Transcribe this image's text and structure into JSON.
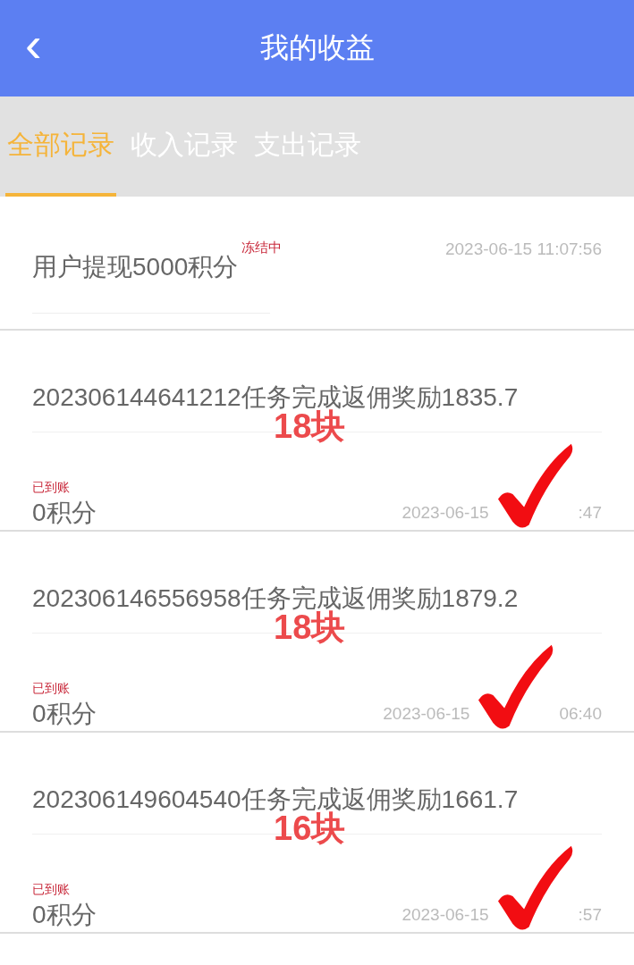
{
  "header": {
    "back": "‹",
    "title": "我的收益"
  },
  "tabs": [
    {
      "label": "全部记录",
      "selected": true
    },
    {
      "label": "收入记录",
      "selected": false
    },
    {
      "label": "支出记录",
      "selected": false
    }
  ],
  "records": [
    {
      "kind": "withdrawal",
      "title": "用户提现5000积分",
      "status": "冻结中",
      "date": "2023-06-15 11:07:56"
    },
    {
      "kind": "reward",
      "title": "202306144641212任务完成返佣奖励1835.7",
      "title_continued": "0积分",
      "status": "已到账",
      "date": "2023-06-15",
      "time_visible": ":47",
      "annotation": "18块"
    },
    {
      "kind": "reward",
      "title": "202306146556958任务完成返佣奖励1879.2",
      "title_continued": "0积分",
      "status": "已到账",
      "date": "2023-06-15",
      "time_visible": "06:40",
      "annotation": "18块"
    },
    {
      "kind": "reward",
      "title": "202306149604540任务完成返佣奖励1661.7",
      "title_continued": "0积分",
      "status": "已到账",
      "date": "2023-06-15",
      "time_visible": ":57",
      "annotation": "16块"
    }
  ]
}
